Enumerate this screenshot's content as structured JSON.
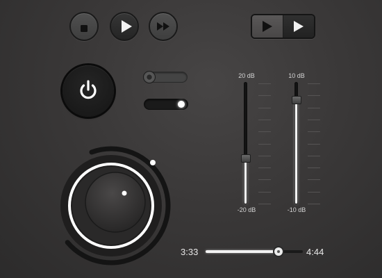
{
  "transport": {
    "buttons": [
      {
        "icon": "stop-icon"
      },
      {
        "icon": "play-icon"
      },
      {
        "icon": "fast-forward-icon"
      }
    ],
    "segmented": [
      {
        "icon": "play-icon",
        "state": "unselected"
      },
      {
        "icon": "play-icon",
        "state": "selected"
      }
    ]
  },
  "power": {
    "icon": "power-icon"
  },
  "toggles": [
    {
      "state": "off"
    },
    {
      "state": "on"
    }
  ],
  "sliders": [
    {
      "max_label": "20 dB",
      "min_label": "-20 dB",
      "min": -20,
      "max": 20,
      "value": -5
    },
    {
      "max_label": "10 dB",
      "min_label": "-10 dB",
      "min": -10,
      "max": 10,
      "value": 7
    }
  ],
  "knob": {
    "level": 0.72
  },
  "progress": {
    "elapsed": "3:33",
    "total": "4:44",
    "fraction": 0.75
  },
  "colors": {
    "accent": "#ffffff",
    "background": "#3a3838",
    "dark": "#1a1a1a"
  }
}
